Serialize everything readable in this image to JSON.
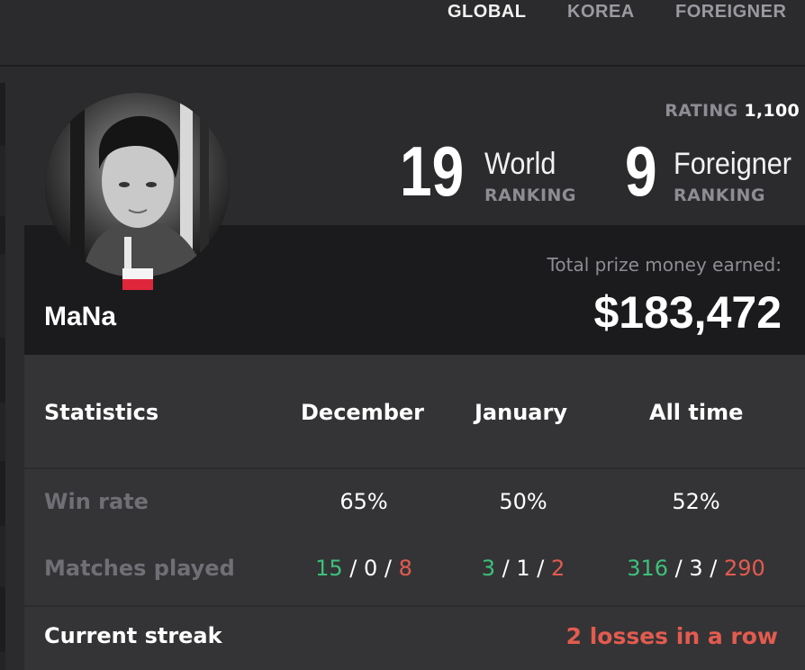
{
  "region_tabs": [
    {
      "label": "GLOBAL",
      "active": true
    },
    {
      "label": "KOREA",
      "active": false
    },
    {
      "label": "FOREIGNER",
      "active": false
    }
  ],
  "player": {
    "name": "MaNa",
    "flag": "Poland",
    "rating_label": "RATING",
    "rating_value": "1,100"
  },
  "rankings": [
    {
      "rank": "19",
      "scope": "World",
      "sub": "RANKING"
    },
    {
      "rank": "9",
      "scope": "Foreigner",
      "sub": "RANKING"
    }
  ],
  "prize": {
    "label": "Total prize money earned:",
    "value": "$183,472"
  },
  "stats": {
    "headers": [
      "Statistics",
      "December",
      "January",
      "All time"
    ],
    "win_rate": {
      "label": "Win rate",
      "values": [
        "65%",
        "50%",
        "52%"
      ]
    },
    "matches_played": {
      "label": "Matches played",
      "values": [
        {
          "wins": "15",
          "draws": "0",
          "losses": "8"
        },
        {
          "wins": "3",
          "draws": "1",
          "losses": "2"
        },
        {
          "wins": "316",
          "draws": "3",
          "losses": "290"
        }
      ]
    },
    "current_streak": {
      "label": "Current streak",
      "value": "2 losses in a row"
    }
  },
  "colors": {
    "win": "#3ec07a",
    "loss": "#e35b4f",
    "muted": "#8d8d93",
    "background": "#2b2b2d"
  }
}
